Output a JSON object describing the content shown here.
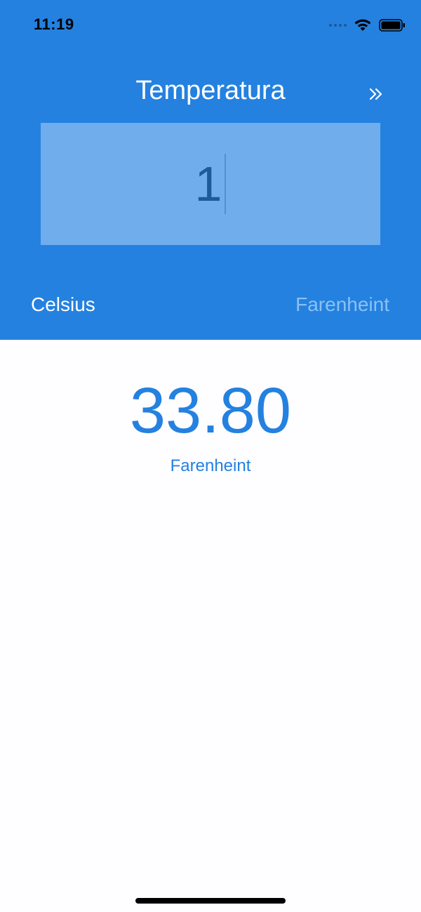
{
  "status_bar": {
    "time": "11:19"
  },
  "header": {
    "title": "Temperatura",
    "forward_icon": "double-chevron-right-icon"
  },
  "input": {
    "value": "1"
  },
  "units": {
    "from": "Celsius",
    "to": "Farenheint"
  },
  "result": {
    "value": "33.80",
    "unit": "Farenheint"
  },
  "colors": {
    "header_background": "#2481df",
    "input_background": "#70aded",
    "input_text": "#1d5a99",
    "inactive_unit": "#8bc0f5",
    "result_text": "#2481df",
    "page_background": "#fefdff"
  }
}
